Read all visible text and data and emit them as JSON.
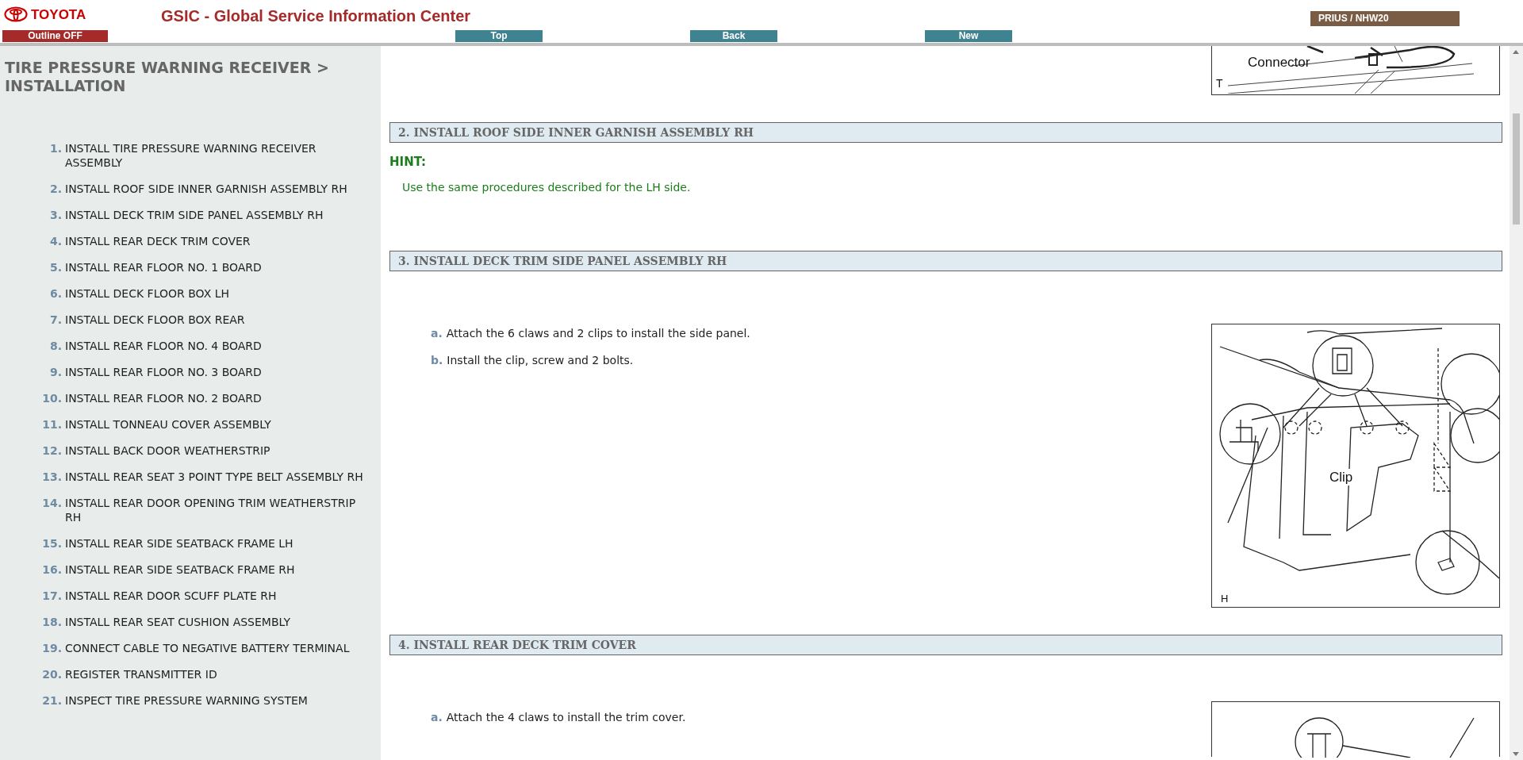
{
  "header": {
    "logo": "TOYOTA",
    "title": "GSIC - Global Service Information Center",
    "outline_button": "Outline OFF",
    "nav_buttons": [
      "Top",
      "Back",
      "New"
    ],
    "model": "PRIUS / NHW20"
  },
  "sidebar": {
    "title": "TIRE PRESSURE WARNING RECEIVER > INSTALLATION",
    "items": [
      {
        "number": "1.",
        "label": "INSTALL TIRE PRESSURE WARNING RECEIVER ASSEMBLY"
      },
      {
        "number": "2.",
        "label": "INSTALL ROOF SIDE INNER GARNISH ASSEMBLY RH"
      },
      {
        "number": "3.",
        "label": "INSTALL DECK TRIM SIDE PANEL ASSEMBLY RH"
      },
      {
        "number": "4.",
        "label": "INSTALL REAR DECK TRIM COVER"
      },
      {
        "number": "5.",
        "label": "INSTALL REAR FLOOR NO. 1 BOARD"
      },
      {
        "number": "6.",
        "label": "INSTALL DECK FLOOR BOX LH"
      },
      {
        "number": "7.",
        "label": "INSTALL DECK FLOOR BOX REAR"
      },
      {
        "number": "8.",
        "label": "INSTALL REAR FLOOR NO. 4 BOARD"
      },
      {
        "number": "9.",
        "label": "INSTALL REAR FLOOR NO. 3 BOARD"
      },
      {
        "number": "10.",
        "label": "INSTALL REAR FLOOR NO. 2 BOARD"
      },
      {
        "number": "11.",
        "label": "INSTALL TONNEAU COVER ASSEMBLY"
      },
      {
        "number": "12.",
        "label": "INSTALL BACK DOOR WEATHERSTRIP"
      },
      {
        "number": "13.",
        "label": "INSTALL REAR SEAT 3 POINT TYPE BELT ASSEMBLY RH"
      },
      {
        "number": "14.",
        "label": "INSTALL REAR DOOR OPENING TRIM WEATHERSTRIP RH"
      },
      {
        "number": "15.",
        "label": "INSTALL REAR SIDE SEATBACK FRAME LH"
      },
      {
        "number": "16.",
        "label": "INSTALL REAR SIDE SEATBACK FRAME RH"
      },
      {
        "number": "17.",
        "label": "INSTALL REAR DOOR SCUFF PLATE RH"
      },
      {
        "number": "18.",
        "label": "INSTALL REAR SEAT CUSHION ASSEMBLY"
      },
      {
        "number": "19.",
        "label": "CONNECT CABLE TO NEGATIVE BATTERY TERMINAL"
      },
      {
        "number": "20.",
        "label": "REGISTER TRANSMITTER ID"
      },
      {
        "number": "21.",
        "label": "INSPECT TIRE PRESSURE WARNING SYSTEM"
      }
    ]
  },
  "content": [
    {
      "kind": "figure-tail",
      "labels": [
        "Connector",
        "T"
      ]
    },
    {
      "kind": "heading",
      "text": "2. INSTALL ROOF SIDE INNER GARNISH ASSEMBLY RH"
    },
    {
      "kind": "hint",
      "label": "HINT:",
      "text": "Use the same procedures described for the LH side."
    },
    {
      "kind": "heading",
      "text": "3. INSTALL DECK TRIM SIDE PANEL ASSEMBLY RH"
    },
    {
      "kind": "steps",
      "steps": [
        {
          "letter": "a.",
          "text": "Attach the 6 claws and 2 clips to install the side panel."
        },
        {
          "letter": "b.",
          "text": "Install the clip, screw and 2 bolts."
        }
      ],
      "figure_labels": [
        "Clip",
        "H"
      ]
    },
    {
      "kind": "heading",
      "text": "4. INSTALL REAR DECK TRIM COVER"
    },
    {
      "kind": "steps",
      "steps": [
        {
          "letter": "a.",
          "text": "Attach the 4 claws to install the trim cover."
        }
      ]
    }
  ]
}
